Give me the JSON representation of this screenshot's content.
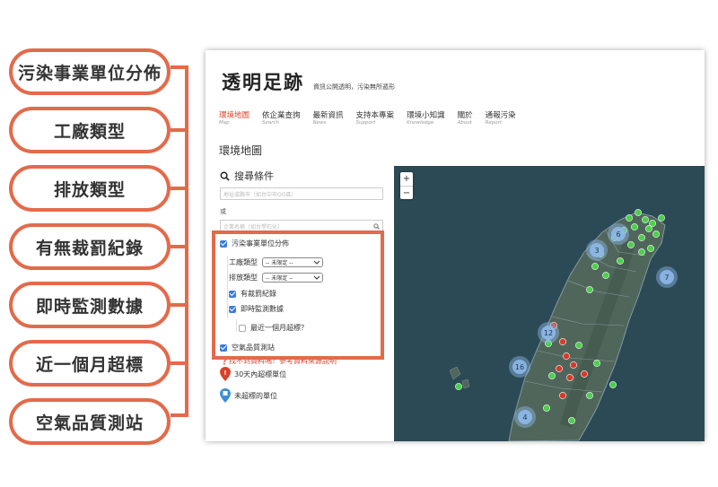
{
  "callouts": [
    "污染事業單位分佈",
    "工廠類型",
    "排放類型",
    "有無裁罰紀錄",
    "即時監測數據",
    "近一個月超標",
    "空氣品質測站"
  ],
  "brand": {
    "name": "透明足跡",
    "tagline": "資訊公開透明，污染無所遁形"
  },
  "nav": [
    {
      "zh": "環境地圖",
      "en": "Map",
      "active": true
    },
    {
      "zh": "依企業查詢",
      "en": "Search"
    },
    {
      "zh": "最新資訊",
      "en": "News"
    },
    {
      "zh": "支持本專案",
      "en": "Support"
    },
    {
      "zh": "環境小知識",
      "en": "Knowledge"
    },
    {
      "zh": "關於",
      "en": "About"
    },
    {
      "zh": "通報污染",
      "en": "Report"
    }
  ],
  "page_title": "環境地圖",
  "search": {
    "heading": "搜尋條件",
    "address_placeholder": "地址或縣市（如台中市OO區）",
    "or_label": "或",
    "company_placeholder": "企業名稱（如台塑石化）"
  },
  "filters": {
    "pollution_units": "污染事業單位分佈",
    "factory_type_label": "工廠類型",
    "factory_type_value": "-- 未限定 --",
    "emission_type_label": "排放類型",
    "emission_type_value": "-- 未限定 --",
    "penalty_record": "有裁罰紀錄",
    "realtime_monitoring": "即時監測數據",
    "last_month_exceed": "最近一個月超標？",
    "air_quality_station": "空氣品質測站"
  },
  "hint": "找不到資料嗎？參考資料來源說明",
  "legend": [
    {
      "label": "30天內超標單位",
      "color": "#d8432c"
    },
    {
      "label": "未超標的單位",
      "color": "#3b8ed6"
    }
  ],
  "map": {
    "zoom_in": "+",
    "zoom_out": "−",
    "clusters": [
      {
        "label": "6"
      },
      {
        "label": "3"
      },
      {
        "label": "7"
      },
      {
        "label": "12"
      },
      {
        "label": "16"
      },
      {
        "label": "4"
      }
    ]
  },
  "colors": {
    "accent": "#e36a4a",
    "active_nav": "#d8432c",
    "map_sea": "#2b4a56",
    "marker_green": "#4cd04c",
    "marker_red": "#d83a2a",
    "cluster": "#8fb8e8"
  }
}
